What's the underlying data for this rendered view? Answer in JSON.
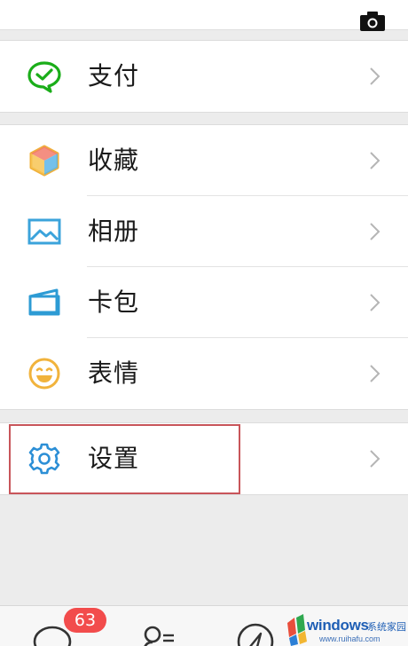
{
  "header": {
    "camera_icon": "camera-icon"
  },
  "groups": [
    {
      "items": [
        {
          "label": "支付",
          "icon": "wallet-chat-icon",
          "color": "#1aad19"
        }
      ]
    },
    {
      "items": [
        {
          "label": "收藏",
          "icon": "cube-icon",
          "color": "#f0b03a"
        },
        {
          "label": "相册",
          "icon": "image-icon",
          "color": "#3ba3db"
        },
        {
          "label": "卡包",
          "icon": "card-icon",
          "color": "#2d9bd4"
        },
        {
          "label": "表情",
          "icon": "smile-icon",
          "color": "#f1b33c"
        }
      ]
    },
    {
      "items": [
        {
          "label": "设置",
          "icon": "gear-icon",
          "color": "#2c8fd6"
        }
      ]
    }
  ],
  "tabbar": {
    "badge": "63",
    "tabs": [
      "chat-icon",
      "contacts-icon",
      "discover-icon"
    ]
  },
  "highlight_color": "#c8555a",
  "watermark": {
    "brand": "windows",
    "sub": "系统家园",
    "url": "www.ruihafu.com"
  }
}
